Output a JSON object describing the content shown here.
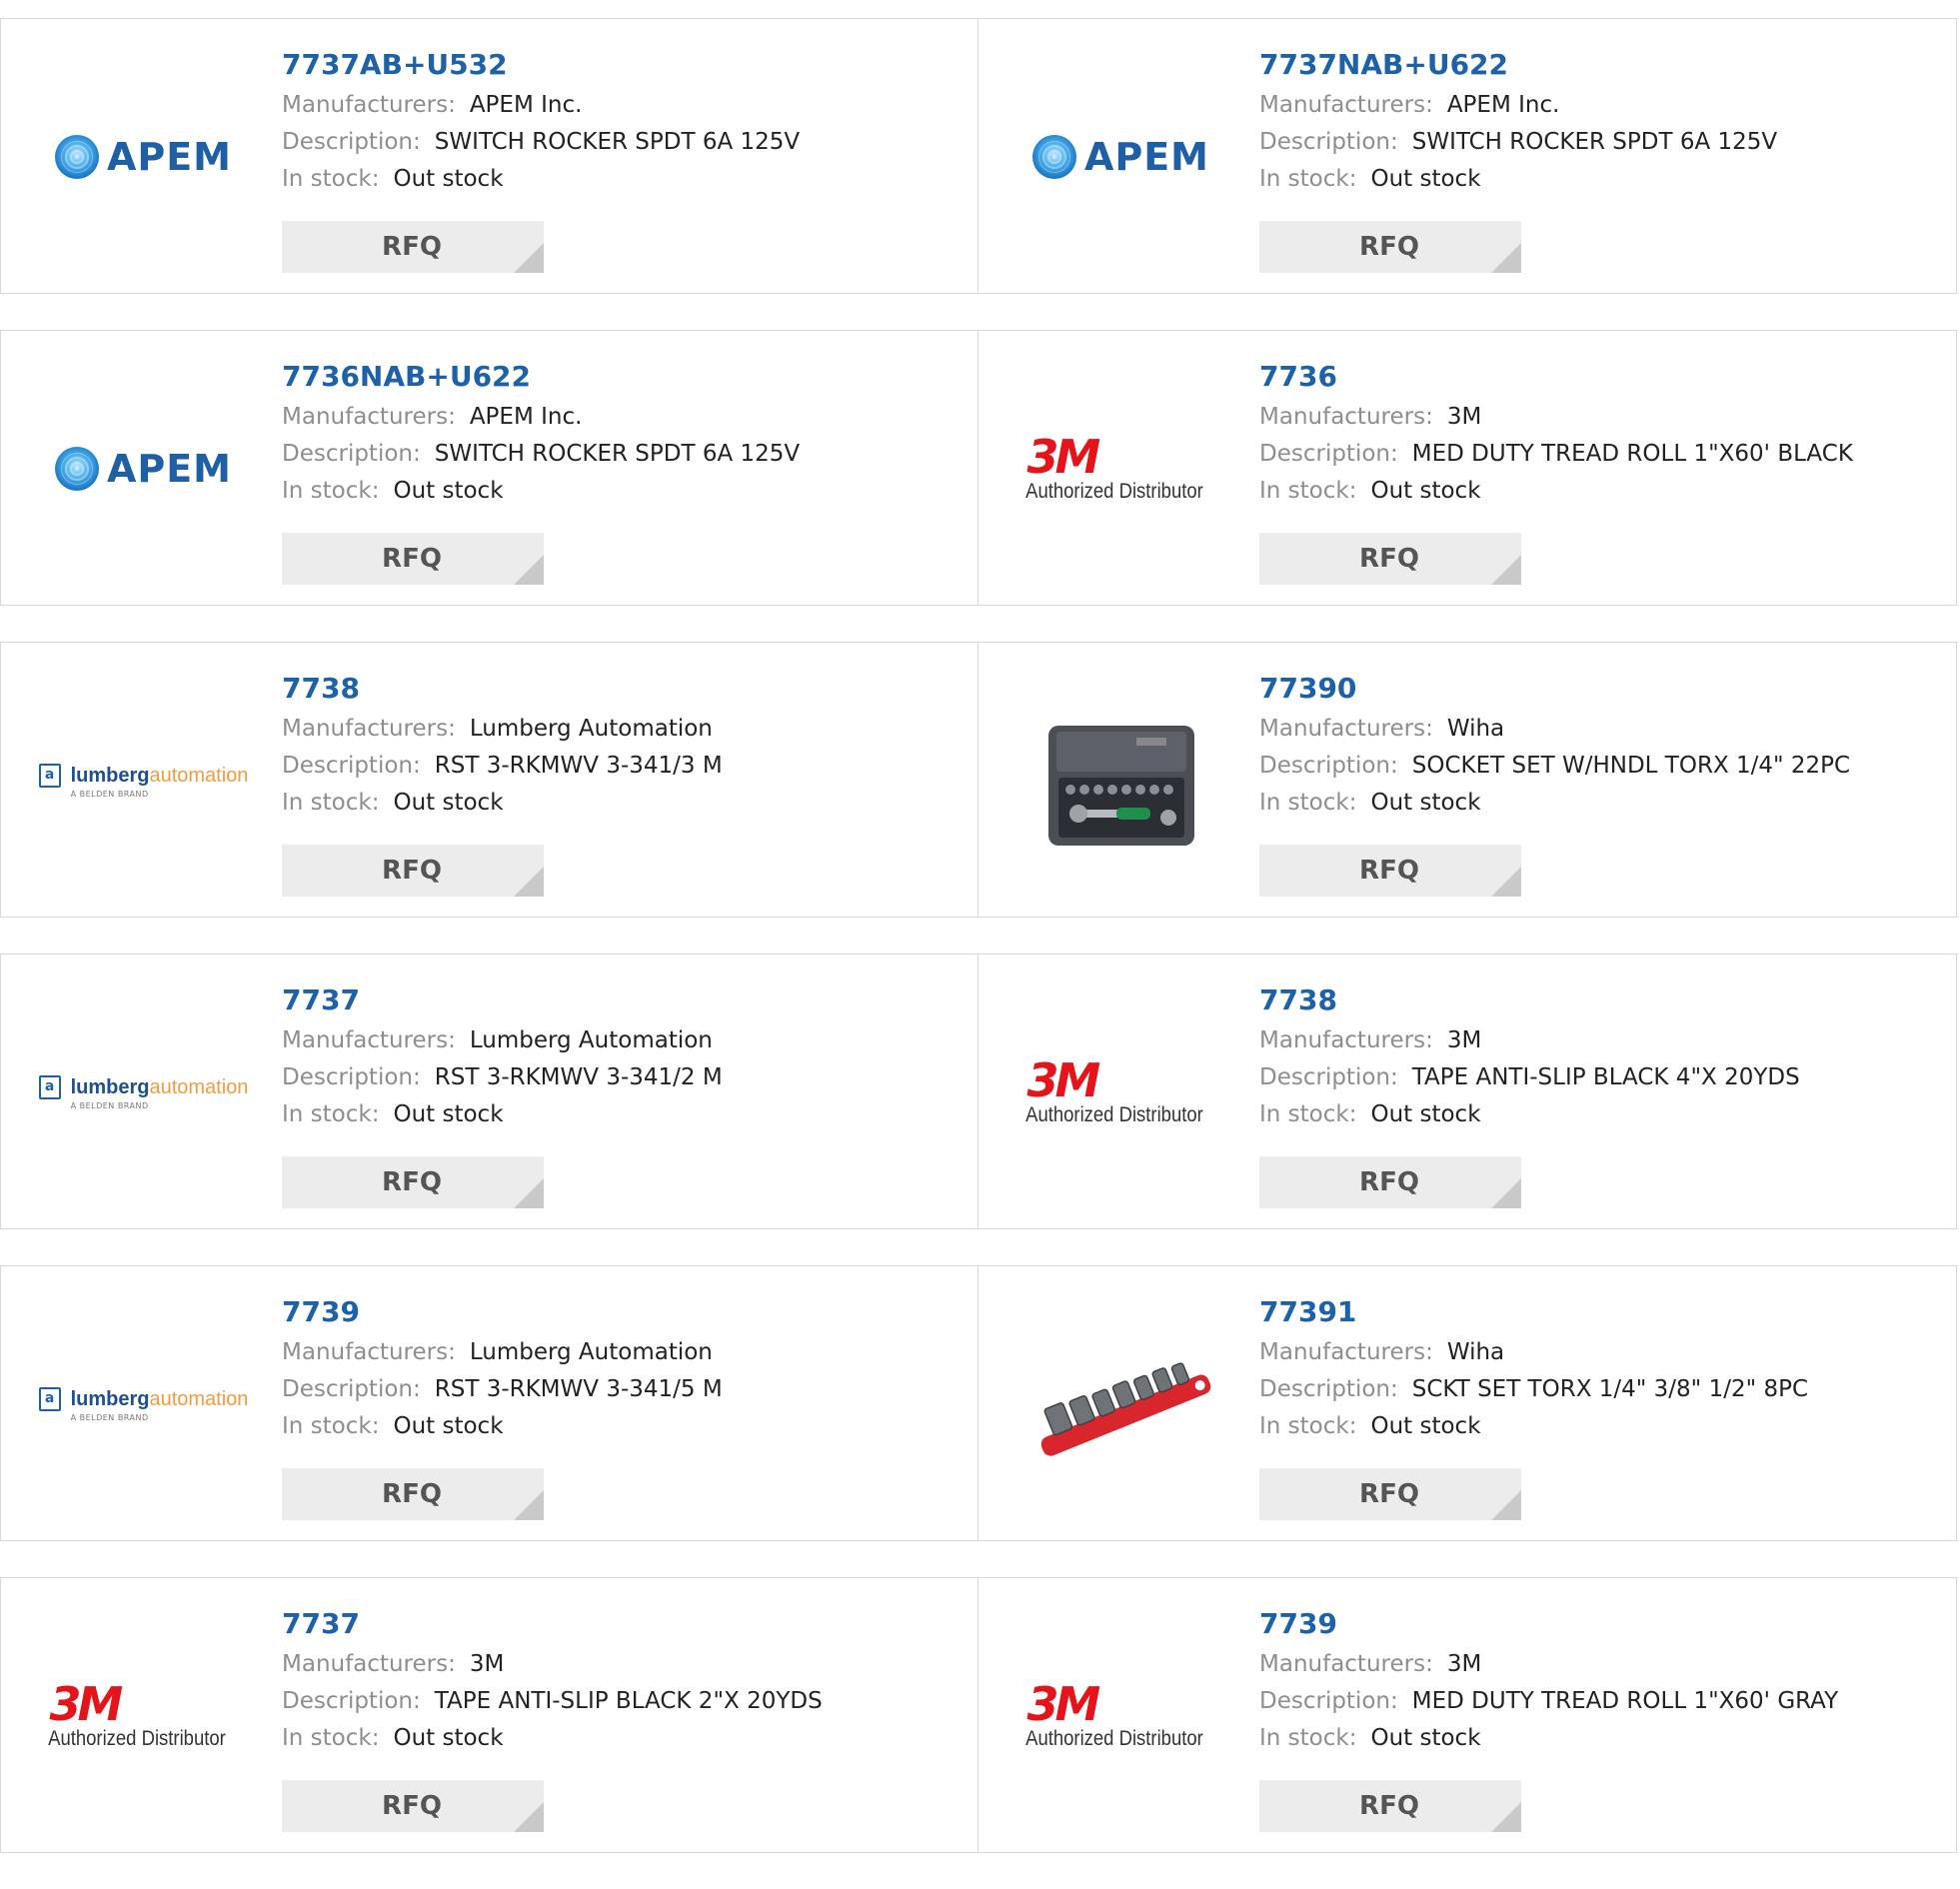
{
  "labels": {
    "manufacturer": "Manufacturers:",
    "description": "Description:",
    "stock": "In stock:",
    "rfq": "RFQ"
  },
  "logos": {
    "apem_text": "APEM",
    "m3_mark": "3M",
    "m3_sub": "Authorized Distributor",
    "lumberg_a": "lumberg",
    "lumberg_b": "automation",
    "lumberg_sub": "A BELDEN BRAND"
  },
  "products": [
    {
      "part": "7737AB+U532",
      "manufacturer": "APEM Inc.",
      "description": "SWITCH ROCKER SPDT 6A 125V",
      "stock": "Out stock",
      "logo": "apem-logo"
    },
    {
      "part": "7737NAB+U622",
      "manufacturer": "APEM Inc.",
      "description": "SWITCH ROCKER SPDT 6A 125V",
      "stock": "Out stock",
      "logo": "apem-logo"
    },
    {
      "part": "7736NAB+U622",
      "manufacturer": "APEM Inc.",
      "description": "SWITCH ROCKER SPDT 6A 125V",
      "stock": "Out stock",
      "logo": "apem-logo"
    },
    {
      "part": "7736",
      "manufacturer": "3M",
      "description": "MED DUTY TREAD ROLL 1\"X60' BLACK",
      "stock": "Out stock",
      "logo": "3m-logo"
    },
    {
      "part": "7738",
      "manufacturer": "Lumberg Automation",
      "description": "RST 3-RKMWV 3-341/3 M",
      "stock": "Out stock",
      "logo": "lumberg-logo"
    },
    {
      "part": "77390",
      "manufacturer": "Wiha",
      "description": "SOCKET SET W/HNDL TORX 1/4\" 22PC",
      "stock": "Out stock",
      "logo": "socket-case-photo"
    },
    {
      "part": "7737",
      "manufacturer": "Lumberg Automation",
      "description": "RST 3-RKMWV 3-341/2 M",
      "stock": "Out stock",
      "logo": "lumberg-logo"
    },
    {
      "part": "7738",
      "manufacturer": "3M",
      "description": "TAPE ANTI-SLIP BLACK 4\"X 20YDS",
      "stock": "Out stock",
      "logo": "3m-logo"
    },
    {
      "part": "7739",
      "manufacturer": "Lumberg Automation",
      "description": "RST 3-RKMWV 3-341/5 M",
      "stock": "Out stock",
      "logo": "lumberg-logo"
    },
    {
      "part": "77391",
      "manufacturer": "Wiha",
      "description": "SCKT SET TORX 1/4\" 3/8\" 1/2\" 8PC",
      "stock": "Out stock",
      "logo": "socket-rail-photo"
    },
    {
      "part": "7737",
      "manufacturer": "3M",
      "description": "TAPE ANTI-SLIP BLACK 2\"X 20YDS",
      "stock": "Out stock",
      "logo": "3m-logo"
    },
    {
      "part": "7739",
      "manufacturer": "3M",
      "description": "MED DUTY TREAD ROLL 1\"X60' GRAY",
      "stock": "Out stock",
      "logo": "3m-logo"
    }
  ],
  "colors": {
    "part_link": "#1d62a8",
    "label": "#8e8e8e",
    "value": "#222222",
    "rfq_bg": "#ececec",
    "border": "#d9d9d9",
    "brand_3m": "#e5141b"
  }
}
